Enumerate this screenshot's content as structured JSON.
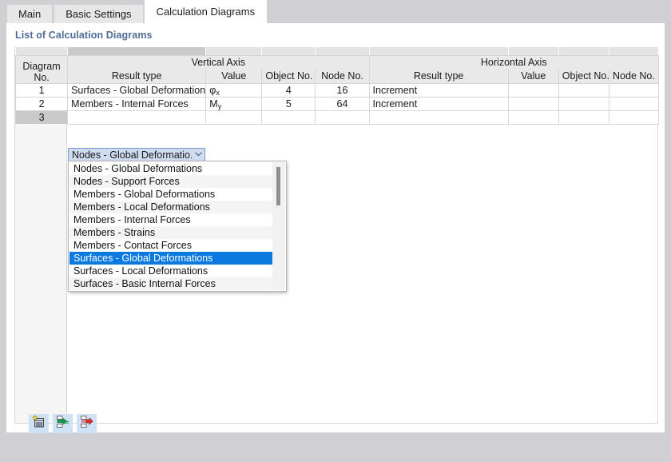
{
  "window": {
    "tabs": [
      {
        "label": "Main",
        "active": false
      },
      {
        "label": "Basic Settings",
        "active": false
      },
      {
        "label": "Calculation Diagrams",
        "active": true
      }
    ]
  },
  "panel": {
    "section_title": "List of Calculation Diagrams",
    "accent_color": "#4f6d96"
  },
  "table": {
    "group_headers": {
      "diagram_no_line1": "Diagram",
      "diagram_no_line2": "No.",
      "vertical_axis": "Vertical Axis",
      "horizontal_axis": "Horizontal Axis"
    },
    "sub_headers": {
      "result_type": "Result type",
      "value": "Value",
      "object_no": "Object No.",
      "node_no": "Node No."
    },
    "rows": [
      {
        "no": "1",
        "v_result_type": "Surfaces - Global Deformations",
        "v_value": "φx",
        "v_value_base": "φ",
        "v_value_sub": "x",
        "v_object_no": "4",
        "v_node_no": "16",
        "h_result_type": "Increment",
        "h_value": "",
        "h_object_no": "",
        "h_node_no": "",
        "selected": false
      },
      {
        "no": "2",
        "v_result_type": "Members - Internal Forces",
        "v_value": "My",
        "v_value_base": "M",
        "v_value_sub": "y",
        "v_object_no": "5",
        "v_node_no": "64",
        "h_result_type": "Increment",
        "h_value": "",
        "h_object_no": "",
        "h_node_no": "",
        "selected": false
      },
      {
        "no": "3",
        "v_result_type": "Nodes - Global Deformatio...",
        "v_value": "",
        "v_value_base": "",
        "v_value_sub": "",
        "v_object_no": "",
        "v_node_no": "",
        "h_result_type": "",
        "h_value": "",
        "h_object_no": "",
        "h_node_no": "",
        "selected": true
      }
    ]
  },
  "combobox": {
    "value": "Nodes - Global Deformatio...",
    "chevron": "⌄",
    "expanded": true,
    "highlight_color": "#0a7ae0",
    "options": [
      {
        "label": "Nodes - Global Deformations",
        "selected": false
      },
      {
        "label": "Nodes - Support Forces",
        "selected": false
      },
      {
        "label": "Members - Global Deformations",
        "selected": false
      },
      {
        "label": "Members - Local Deformations",
        "selected": false
      },
      {
        "label": "Members - Internal Forces",
        "selected": false
      },
      {
        "label": "Members - Strains",
        "selected": false
      },
      {
        "label": "Members - Contact Forces",
        "selected": false
      },
      {
        "label": "Surfaces - Global Deformations",
        "selected": true
      },
      {
        "label": "Surfaces - Local Deformations",
        "selected": false
      },
      {
        "label": "Surfaces - Basic Internal Forces",
        "selected": false
      }
    ]
  },
  "toolbar": {
    "buttons": [
      {
        "name": "new-diagram-icon",
        "title": "New"
      },
      {
        "name": "insert-row-icon",
        "title": "Insert Row"
      },
      {
        "name": "delete-row-icon",
        "title": "Delete Row"
      }
    ]
  }
}
